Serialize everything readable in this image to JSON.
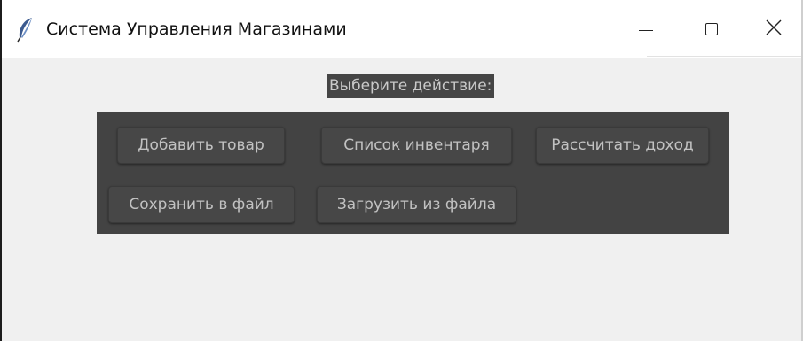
{
  "window": {
    "title": "Система Управления Магазинами",
    "controls": {
      "minimize": "minimize-icon",
      "maximize": "maximize-icon",
      "close": "close-icon"
    }
  },
  "main": {
    "prompt": "Выберите действие:",
    "buttons": {
      "add_item": "Добавить товар",
      "inventory_list": "Список инвентаря",
      "calc_income": "Рассчитать доход",
      "save_file": "Сохранить в файл",
      "load_file": "Загрузить из файла"
    }
  },
  "colors": {
    "panel": "#434343",
    "button": "#474747",
    "button_text": "#c2c2c2",
    "window_bg": "#f0f0f0"
  }
}
